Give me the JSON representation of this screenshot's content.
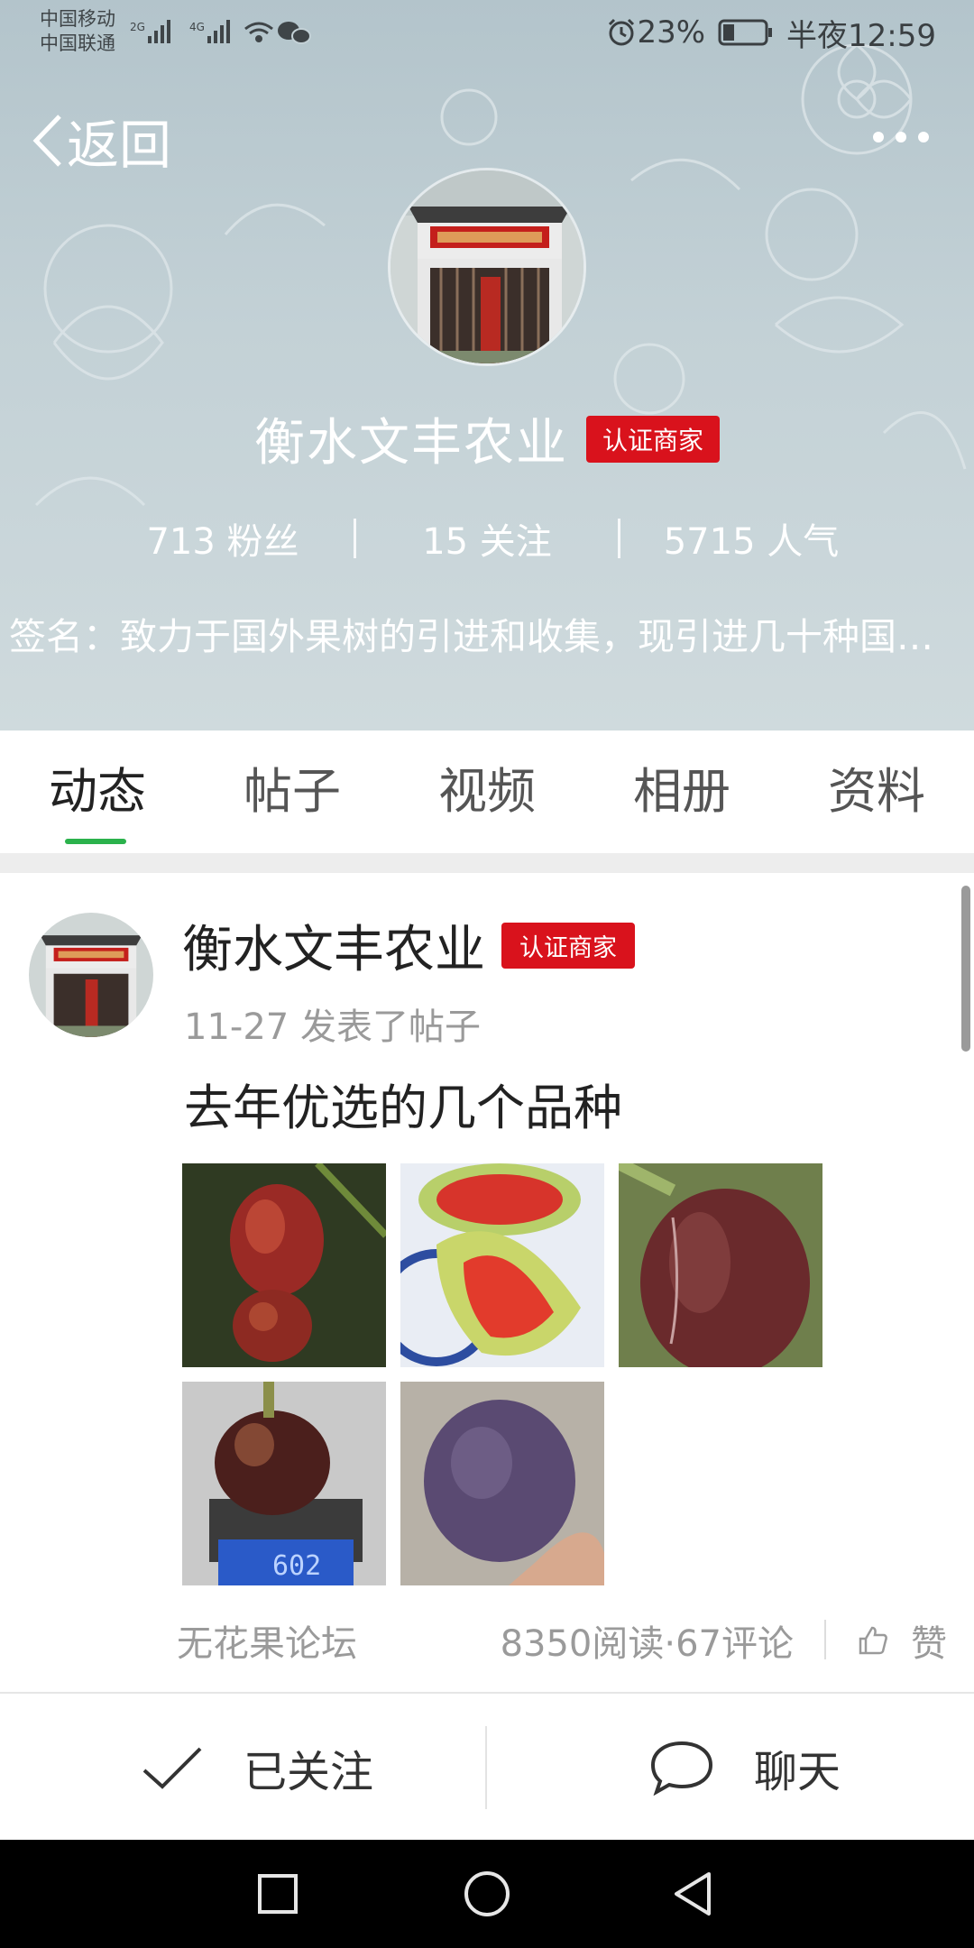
{
  "status_bar": {
    "carrier1": "中国移动",
    "carrier2": "中国联通",
    "battery_percent": "23%",
    "time": "半夜12:59"
  },
  "header": {
    "back_label": "返回",
    "profile_name": "衡水文丰农业",
    "badge": "认证商家",
    "stats": {
      "fans": "713 粉丝",
      "following": "15 关注",
      "popularity": "5715 人气"
    },
    "signature": "签名：致力于国外果树的引进和收集，现引进几十种国外果树品种"
  },
  "tabs": [
    {
      "label": "动态",
      "active": true
    },
    {
      "label": "帖子",
      "active": false
    },
    {
      "label": "视频",
      "active": false
    },
    {
      "label": "相册",
      "active": false
    },
    {
      "label": "资料",
      "active": false
    }
  ],
  "post": {
    "author": "衡水文丰农业",
    "badge": "认证商家",
    "meta": "11-27 发表了帖子",
    "title": "去年优选的几个品种",
    "forum": "无花果论坛",
    "counts": "8350阅读·67评论",
    "like_label": "赞",
    "scale_reading": "602"
  },
  "actions": {
    "follow_label": "已关注",
    "chat_label": "聊天"
  },
  "colors": {
    "accent_green": "#2bb24c",
    "badge_red": "#d9121c",
    "header_bg": "#c3d1d6"
  },
  "icons": [
    "back-chevron-icon",
    "more-icon",
    "alarm-icon",
    "battery-icon",
    "wifi-icon",
    "wechat-icon",
    "thumb-up-icon",
    "check-icon",
    "chat-bubble-icon",
    "nav-square-icon",
    "nav-circle-icon",
    "nav-triangle-icon"
  ]
}
